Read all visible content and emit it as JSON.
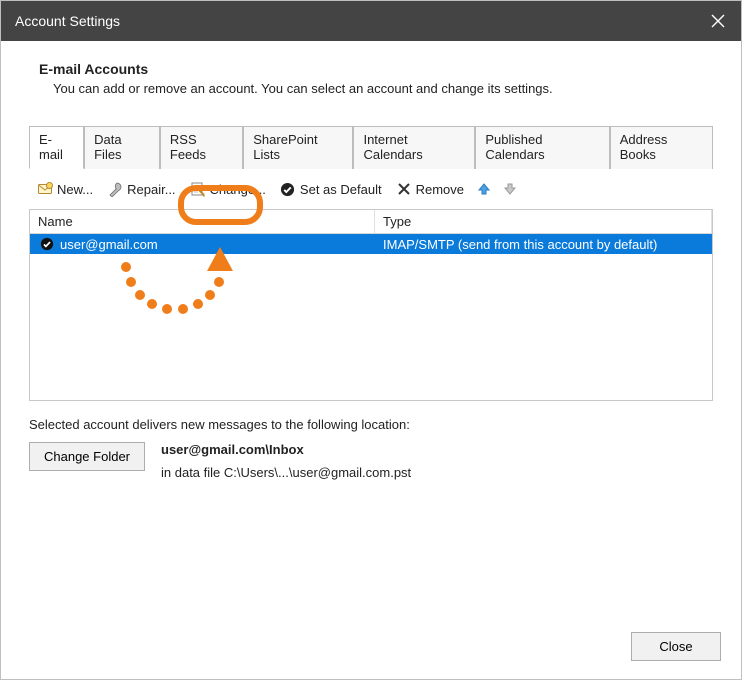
{
  "window": {
    "title": "Account Settings"
  },
  "header": {
    "title": "E-mail Accounts",
    "description": "You can add or remove an account. You can select an account and change its settings."
  },
  "tabs": [
    {
      "label": "E-mail",
      "active": true
    },
    {
      "label": "Data Files"
    },
    {
      "label": "RSS Feeds"
    },
    {
      "label": "SharePoint Lists"
    },
    {
      "label": "Internet Calendars"
    },
    {
      "label": "Published Calendars"
    },
    {
      "label": "Address Books"
    }
  ],
  "toolbar": {
    "new": "New...",
    "repair": "Repair...",
    "change": "Change...",
    "set_default": "Set as Default",
    "remove": "Remove"
  },
  "list": {
    "columns": {
      "name": "Name",
      "type": "Type"
    },
    "rows": [
      {
        "name": "user@gmail.com",
        "type": "IMAP/SMTP (send from this account by default)",
        "default": true
      }
    ]
  },
  "delivery": {
    "label": "Selected account delivers new messages to the following location:",
    "change_folder_btn": "Change Folder",
    "location": "user@gmail.com\\Inbox",
    "data_file": "in data file C:\\Users\\...\\user@gmail.com.pst"
  },
  "footer": {
    "close": "Close"
  },
  "icons": {
    "new": "new-mail-icon",
    "repair": "repair-icon",
    "change": "change-icon",
    "set_default": "check-circle-icon",
    "remove": "remove-x-icon",
    "up": "arrow-up-icon",
    "down": "arrow-down-icon",
    "close": "close-icon",
    "default_account": "check-circle-icon"
  },
  "colors": {
    "accent": "#0a7bda",
    "annotation": "#EF7E1A"
  }
}
